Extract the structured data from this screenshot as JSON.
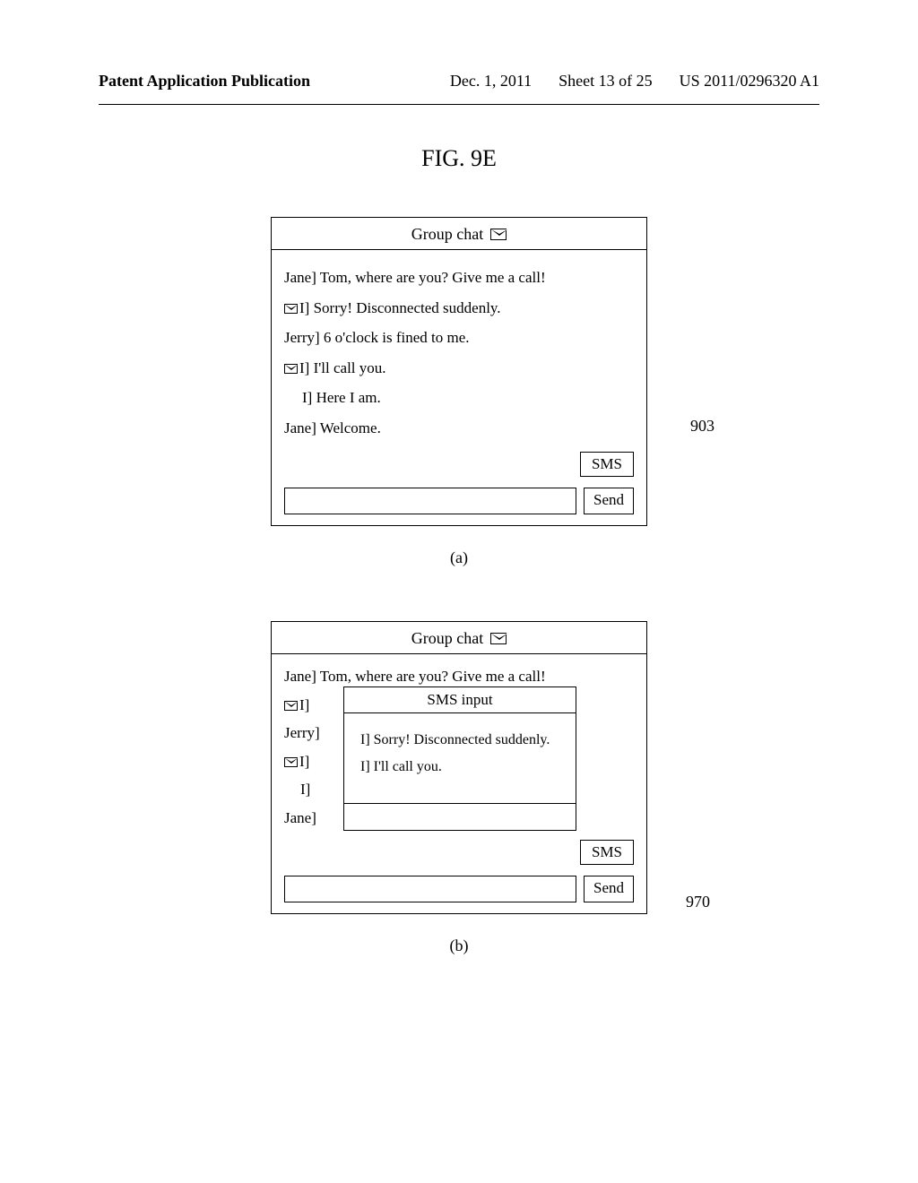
{
  "header": {
    "left": "Patent Application Publication",
    "date": "Dec. 1, 2011",
    "sheet": "Sheet 13 of 25",
    "pubnum": "US 2011/0296320 A1"
  },
  "fig_title": "FIG. 9E",
  "screen_a": {
    "title": "Group chat",
    "lines": {
      "l1": "Jane] Tom, where are you? Give me a call!",
      "l2": "I] Sorry! Disconnected suddenly.",
      "l3": "Jerry] 6 o'clock is fined to me.",
      "l4": "I] I'll call you.",
      "l5": "I] Here I am.",
      "l6": "Jane] Welcome."
    },
    "sms_btn": "SMS",
    "send_btn": "Send",
    "label": "(a)",
    "ref903": "903"
  },
  "screen_b": {
    "title": "Group chat",
    "line1": "Jane] Tom, where are you? Give me a call!",
    "left_labels": {
      "r1": "I]",
      "r2": "Jerry]",
      "r3": "I]",
      "r4": "I]",
      "r5": "Jane]"
    },
    "popup": {
      "title": "SMS input",
      "body1": "I] Sorry! Disconnected suddenly.",
      "body2": "I] I'll call you."
    },
    "sms_btn": "SMS",
    "send_btn": "Send",
    "label": "(b)",
    "ref970": "970"
  }
}
